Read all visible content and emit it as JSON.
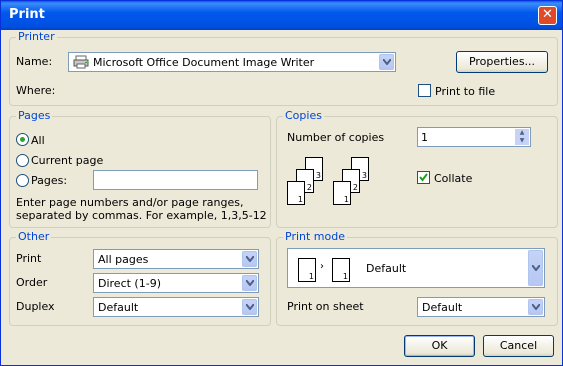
{
  "window": {
    "title": "Print"
  },
  "printer": {
    "legend": "Printer",
    "name_label": "Name:",
    "name_value": "Microsoft Office Document Image Writer",
    "properties_label": "Properties...",
    "where_label": "Where:",
    "print_to_file_label": "Print to file",
    "print_to_file_checked": false
  },
  "pages": {
    "legend": "Pages",
    "all_label": "All",
    "current_page_label": "Current page",
    "pages_label": "Pages:",
    "pages_value": "",
    "selected": "All",
    "hint_line1": "Enter page numbers and/or page ranges,",
    "hint_line2": "separated by commas. For example, 1,3,5-12"
  },
  "copies": {
    "legend": "Copies",
    "number_label": "Number of copies",
    "number_value": "1",
    "collate_label": "Collate",
    "collate_checked": true,
    "stack_numbers": [
      "3",
      "2",
      "1"
    ]
  },
  "other": {
    "legend": "Other",
    "print_label": "Print",
    "print_value": "All pages",
    "order_label": "Order",
    "order_value": "Direct (1-9)",
    "duplex_label": "Duplex",
    "duplex_value": "Default"
  },
  "print_mode": {
    "legend": "Print mode",
    "mode_value": "Default",
    "page_numbers": [
      "1",
      "1"
    ],
    "sheet_label": "Print on sheet",
    "sheet_value": "Default"
  },
  "buttons": {
    "ok": "OK",
    "cancel": "Cancel"
  },
  "colors": {
    "title_bar": "#0058ee",
    "group_legend": "#0046d5",
    "close_button": "#e04a2a"
  }
}
